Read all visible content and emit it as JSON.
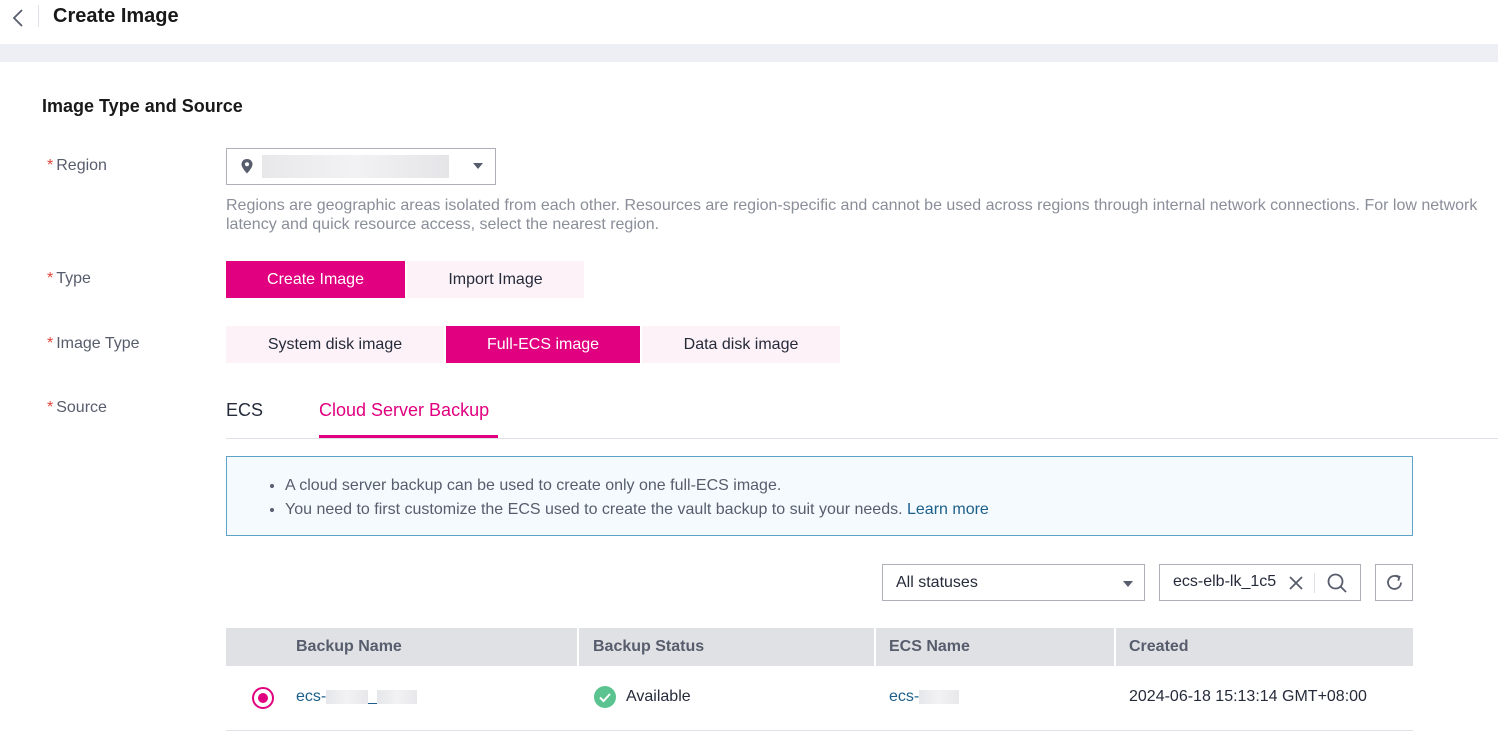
{
  "header": {
    "title": "Create Image"
  },
  "section": {
    "title": "Image Type and Source"
  },
  "fields": {
    "region": {
      "label": "Region",
      "hint": "Regions are geographic areas isolated from each other. Resources are region-specific and cannot be used across regions through internal network connections. For low network latency and quick resource access, select the nearest region."
    },
    "type": {
      "label": "Type",
      "options": [
        "Create Image",
        "Import Image"
      ],
      "selected": "Create Image"
    },
    "image_type": {
      "label": "Image Type",
      "options": [
        "System disk image",
        "Full-ECS image",
        "Data disk image"
      ],
      "selected": "Full-ECS image"
    },
    "source": {
      "label": "Source",
      "tabs": [
        "ECS",
        "Cloud Server Backup"
      ],
      "active_tab": "Cloud Server Backup"
    }
  },
  "info": {
    "bullet1": "A cloud server backup can be used to create only one full-ECS image.",
    "bullet2": "You need to first customize the ECS used to create the vault backup to suit your needs.",
    "learn_more": "Learn more"
  },
  "filter": {
    "status_value": "All statuses",
    "search_value": "ecs-elb-lk_1c5"
  },
  "table": {
    "columns": [
      "Backup Name",
      "Backup Status",
      "ECS Name",
      "Created"
    ],
    "rows": [
      {
        "backup_name": "ecs-",
        "backup_name_tail": "_",
        "status": "Available",
        "ecs_name": "ecs-",
        "created": "2024-06-18 15:13:14 GMT+08:00",
        "selected": true
      }
    ]
  },
  "colors": {
    "accent": "#e1007f",
    "link": "#1c5f8a",
    "success": "#5ac38f"
  }
}
